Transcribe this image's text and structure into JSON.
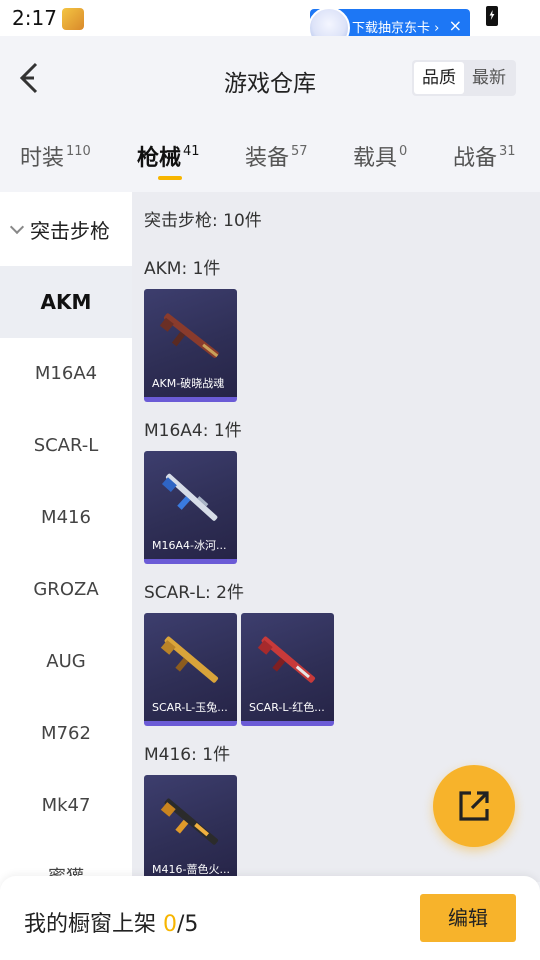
{
  "status_bar": {
    "time": "2:17"
  },
  "ad": {
    "text": "下载抽京东卡 ›",
    "close": "×"
  },
  "header": {
    "title": "游戏仓库",
    "sort_options": [
      "品质",
      "最新"
    ]
  },
  "tabs": [
    {
      "label": "时装",
      "count": "110"
    },
    {
      "label": "枪械",
      "count": "41"
    },
    {
      "label": "装备",
      "count": "57"
    },
    {
      "label": "载具",
      "count": "0"
    },
    {
      "label": "战备",
      "count": "31"
    }
  ],
  "sidebar": {
    "group": "突击步枪",
    "items": [
      "AKM",
      "M16A4",
      "SCAR-L",
      "M416",
      "GROZA",
      "AUG",
      "M762",
      "Mk47",
      "蜜獾"
    ]
  },
  "content": {
    "summary": "突击步枪: 10件",
    "sections": [
      {
        "title": "AKM: 1件",
        "items": [
          "AKM-破晓战魂"
        ]
      },
      {
        "title": "M16A4: 1件",
        "items": [
          "M16A4-冰河..."
        ]
      },
      {
        "title": "SCAR-L: 2件",
        "items": [
          "SCAR-L-玉兔...",
          "SCAR-L-红色..."
        ]
      },
      {
        "title": "M416: 1件",
        "items": [
          "M416-蔷色火..."
        ]
      }
    ]
  },
  "bottom": {
    "shelf_label": "我的橱窗上架 ",
    "shelf_count": "0",
    "shelf_total": "/5",
    "edit_label": "编辑"
  },
  "colors": {
    "accent": "#f7b32b",
    "card_bg": "#2f2f56",
    "card_border": "#6b5bd6",
    "ad_blue": "#1d77f5"
  }
}
